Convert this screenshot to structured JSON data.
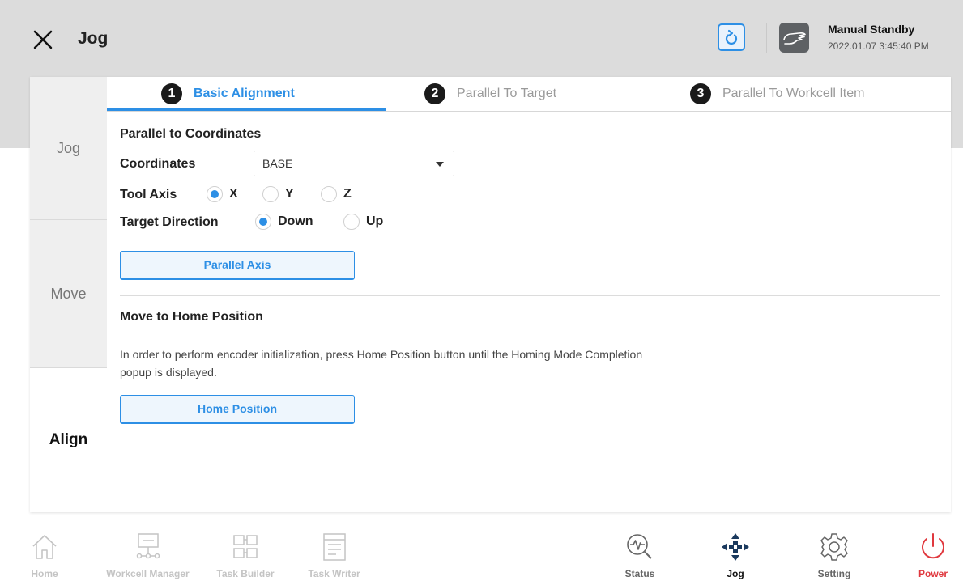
{
  "header": {
    "title": "Jog",
    "status_title": "Manual Standby",
    "status_time": "2022.01.07 3:45:40 PM"
  },
  "sidebar": {
    "items": [
      {
        "label": "Jog",
        "active": false
      },
      {
        "label": "Move",
        "active": false
      },
      {
        "label": "Align",
        "active": true
      }
    ]
  },
  "tabs": [
    {
      "number": "1",
      "label": "Basic Alignment",
      "active": true
    },
    {
      "number": "2",
      "label": "Parallel To Target",
      "active": false
    },
    {
      "number": "3",
      "label": "Parallel To Workcell Item",
      "active": false
    }
  ],
  "parallel": {
    "section_title": "Parallel to Coordinates",
    "coordinates_label": "Coordinates",
    "coordinates_value": "BASE",
    "tool_axis_label": "Tool Axis",
    "tool_axis_options": [
      "X",
      "Y",
      "Z"
    ],
    "tool_axis_selected": "X",
    "target_direction_label": "Target Direction",
    "target_direction_options": [
      "Down",
      "Up"
    ],
    "target_direction_selected": "Down",
    "button_label": "Parallel Axis"
  },
  "home": {
    "section_title": "Move to Home Position",
    "description": "In order to perform encoder initialization, press Home Position button until the Homing Mode Completion popup is displayed.",
    "button_label": "Home Position"
  },
  "bottom_nav": {
    "items": [
      {
        "label": "Home",
        "icon": "home-icon",
        "state": "disabled"
      },
      {
        "label": "Workcell Manager",
        "icon": "workcell-manager-icon",
        "state": "disabled"
      },
      {
        "label": "Task Builder",
        "icon": "task-builder-icon",
        "state": "disabled"
      },
      {
        "label": "Task Writer",
        "icon": "task-writer-icon",
        "state": "disabled"
      },
      {
        "label": "Status",
        "icon": "status-icon",
        "state": "enabled"
      },
      {
        "label": "Jog",
        "icon": "jog-icon",
        "state": "active"
      },
      {
        "label": "Setting",
        "icon": "gear-icon",
        "state": "enabled"
      },
      {
        "label": "Power",
        "icon": "power-icon",
        "state": "power"
      }
    ]
  },
  "colors": {
    "accent": "#2d8fe5",
    "power": "#e0383e",
    "header_background": "#dcdcdc",
    "sidebar_background": "#efefef"
  }
}
